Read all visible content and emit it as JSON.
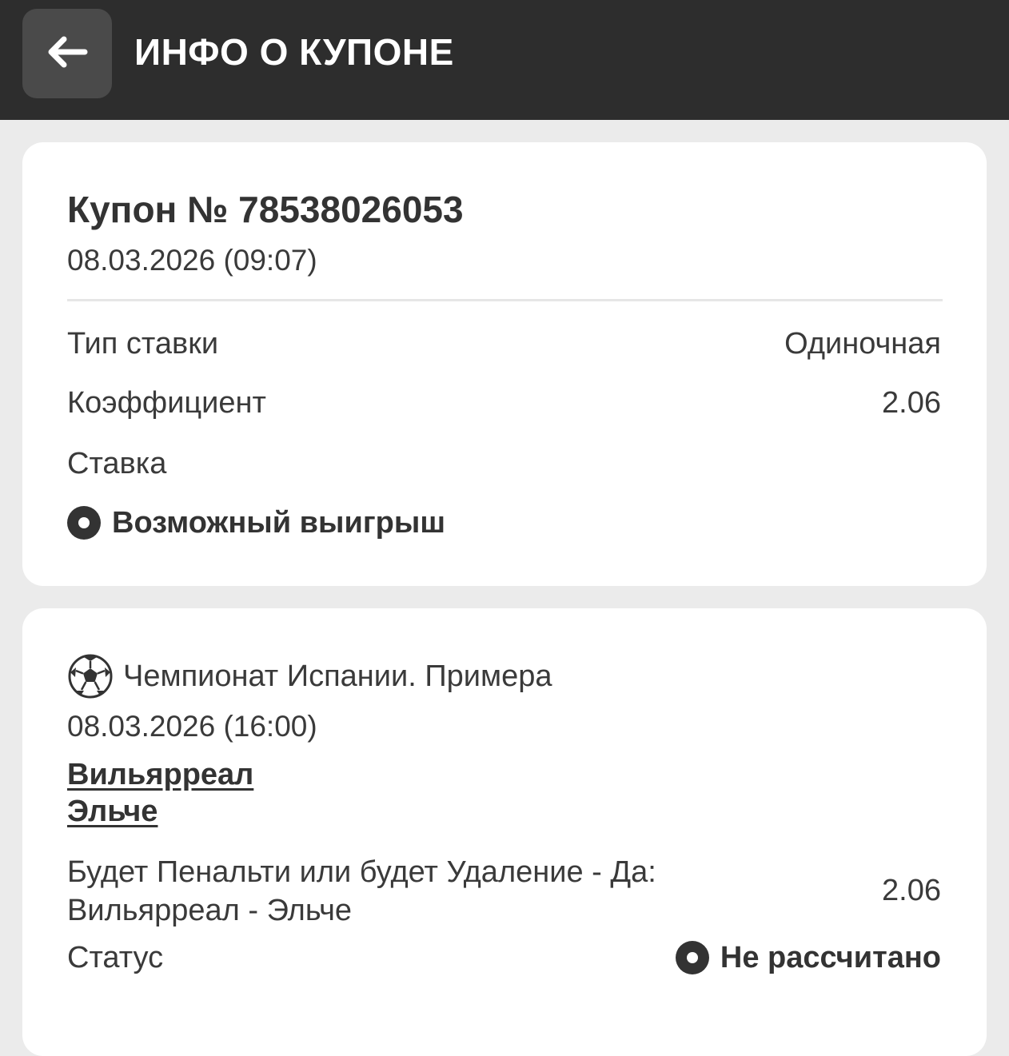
{
  "header": {
    "title": "ИНФО О КУПОНЕ",
    "back_icon": "arrow-left-icon"
  },
  "coupon": {
    "title": "Купон № 78538026053",
    "date": "08.03.2026 (09:07)",
    "rows": [
      {
        "label": "Тип ставки",
        "value": "Одиночная"
      },
      {
        "label": "Коэффициент",
        "value": "2.06"
      },
      {
        "label": "Ставка",
        "value": ""
      },
      {
        "label": "Возможный выигрыш",
        "value": ""
      }
    ]
  },
  "event": {
    "sport_icon": "soccer-ball-icon",
    "league": "Чемпионат Испании. Примера",
    "date": "08.03.2026 (16:00)",
    "team1": "Вильярреал",
    "team2": "Эльче",
    "market": "Будет Пенальти или будет Удаление - Да: Вильярреал - Эльче",
    "odds": "2.06",
    "status_label": "Статус",
    "status_value": "Не рассчитано"
  }
}
